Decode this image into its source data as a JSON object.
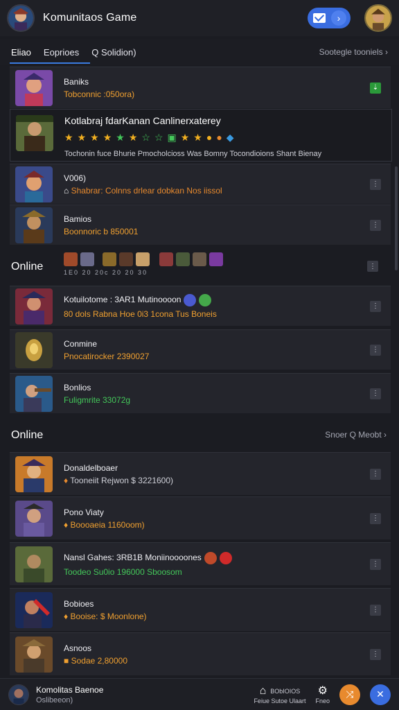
{
  "header": {
    "title": "Komunitaos Game",
    "mail_icon": "mail-icon",
    "go_icon": "chevron-right-icon"
  },
  "tabs": {
    "items": [
      "Eliao",
      "Eoprioes",
      "Q Solidion)"
    ],
    "sort_label": "Sootegle tooniels"
  },
  "featured": {
    "title": "Kotlabraj fdarKanan Canlinerxaterey",
    "description": "Tochonin fuce Bhurie  Pmocholcioss  Was Bomny  Tocondioions  Shant Bienay"
  },
  "list_top": [
    {
      "name": "Baniks",
      "sub": "Tobconnic :050ora)",
      "sub_color": "orange",
      "action": "green"
    },
    {
      "name": "V006)",
      "sub": "Shabrar: Colnns drlear dobkan  Nos iissol",
      "sub_color": "orange",
      "action": "grey"
    },
    {
      "name": "Bamios",
      "sub": "Boonnoric b 850001",
      "sub_color": "orange",
      "action": "grey"
    },
    {
      "name": "Kotuilotome : 3AR1 Mutinoooon",
      "sub": "80 dols  Rabna  Hoe  0i3  1cona  Tus  Boneis",
      "sub_color": "orange",
      "action": "grey"
    },
    {
      "name": "Conmine",
      "sub": "Pnocatirocker 2390027",
      "sub_color": "orange",
      "action": "grey"
    },
    {
      "name": "Bonlios",
      "sub": "Fuligmrite 33072g",
      "sub_color": "green",
      "action": "grey"
    }
  ],
  "online_section": {
    "label": "Online",
    "mini_labels": "1E0  20  20c   20   20   30"
  },
  "online_list": {
    "label": "Online",
    "right_label": "Snoer  Q  Meobt"
  },
  "list_bottom": [
    {
      "name": "Donaldelboaer",
      "sub": "Tooneiit Rejwon  $ 3221600)",
      "sub_color": "orange",
      "action": "grey"
    },
    {
      "name": "Pono Viaty",
      "sub": "Boooaeia 1160oom)",
      "sub_color": "orange",
      "action": "grey"
    },
    {
      "name": "Nansl Gahes: 3RB1B Moniinoooones",
      "sub": "Toodeo  Su0io  196000  Sboosom",
      "sub_color": "green",
      "action": "grey"
    },
    {
      "name": "Bobioes",
      "sub": "Booise: $ Moonlone)",
      "sub_color": "orange",
      "action": "grey"
    },
    {
      "name": "Asnoos",
      "sub": "Sodae 2,80000",
      "sub_color": "orange",
      "action": "grey"
    }
  ],
  "bottom": {
    "title": "Komolitas Baenoe",
    "sub": "Oslibeeon)",
    "nav_home_label": "Feiue Sutoe Ulaart",
    "nav_home_top": "BObIOIOS",
    "nav_settings_label": "Fneo"
  }
}
